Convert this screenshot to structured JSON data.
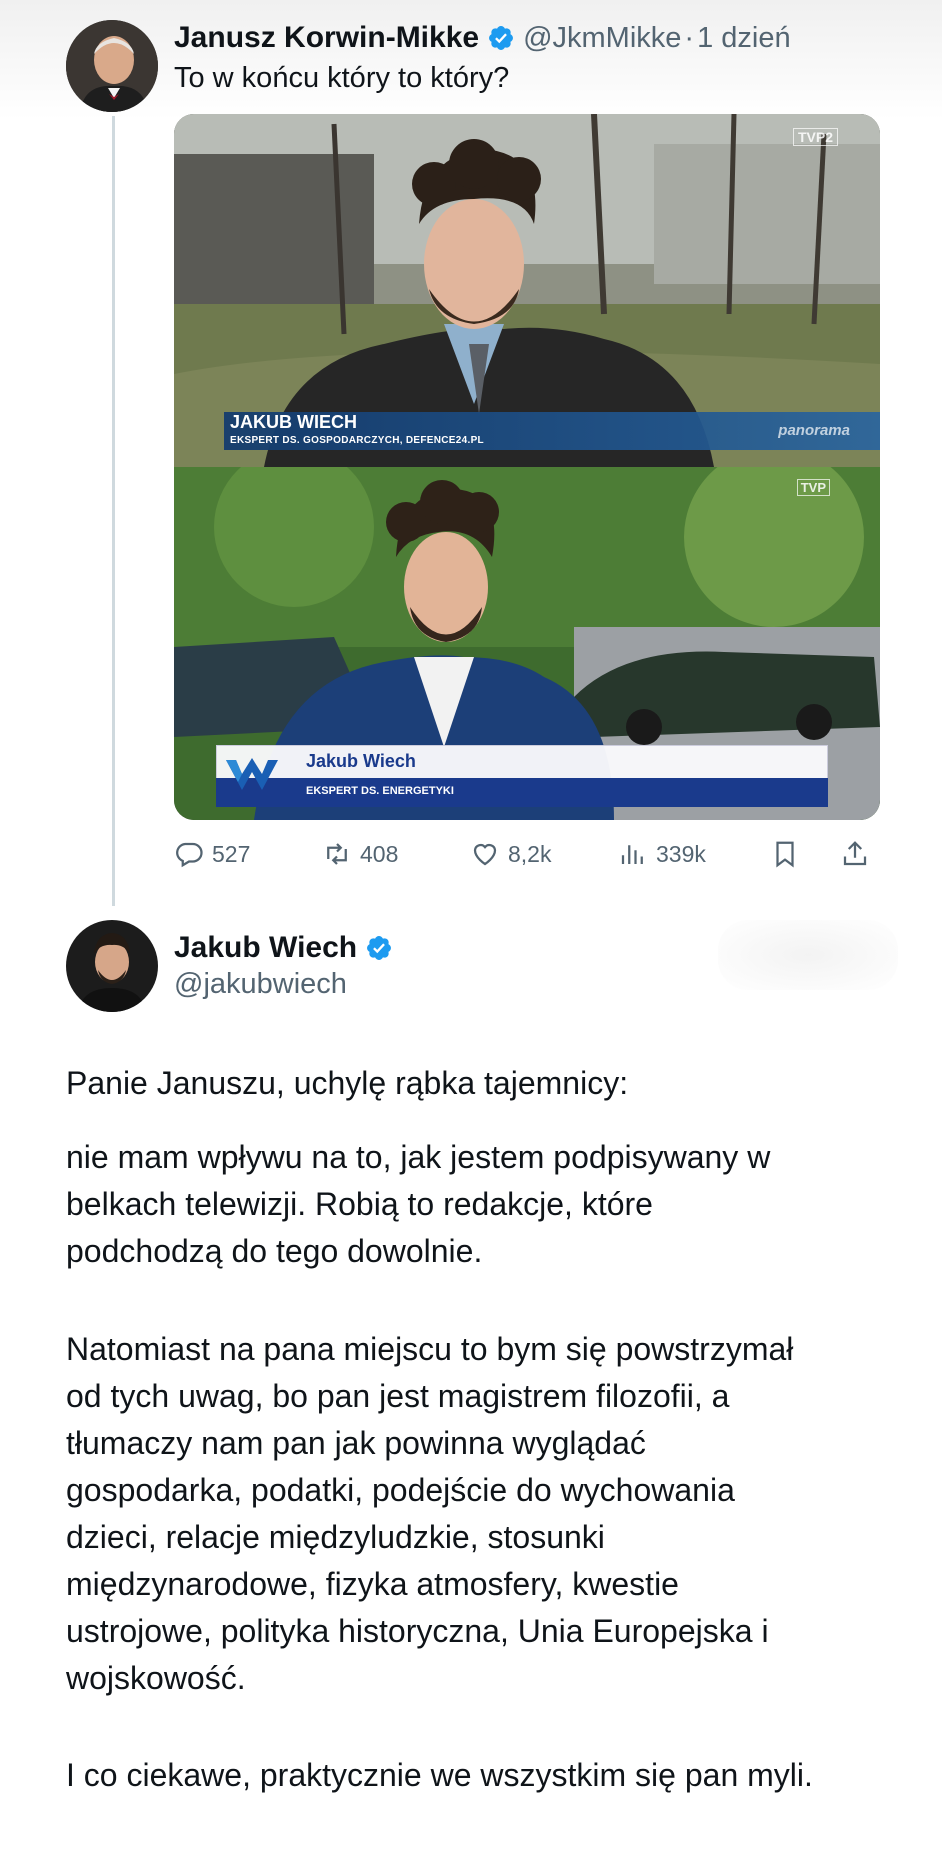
{
  "tweet1": {
    "author_name": "Janusz Korwin-Mikke",
    "handle": "@JkmMikke",
    "separator": "·",
    "time": "1 dzień",
    "text": "To w końcu który to który?",
    "media": {
      "frame1": {
        "channel_logo": "TVP2",
        "lower_third_name": "JAKUB WIECH",
        "lower_third_role": "EKSPERT DS. GOSPODARCZYCH, DEFENCE24.PL",
        "program_logo": "panorama"
      },
      "frame2": {
        "channel_logo": "TVP",
        "lower_third_name": "Jakub Wiech",
        "lower_third_role": "EKSPERT DS. ENERGETYKI"
      }
    },
    "actions": {
      "replies": "527",
      "reposts": "408",
      "likes": "8,2k",
      "views": "339k"
    }
  },
  "tweet2": {
    "author_name": "Jakub Wiech",
    "handle": "@jakubwiech",
    "paragraph1": "Panie Januszu, uchylę rąbka tajemnicy:",
    "paragraph2_lines": [
      "nie mam wpływu na to, jak jestem podpisywany w",
      "belkach telewizji. Robią to redakcje, które",
      "podchodzą do tego dowolnie."
    ],
    "paragraph3_lines": [
      "Natomiast na pana miejscu to bym się powstrzymał",
      "od tych uwag, bo pan jest magistrem filozofii, a",
      "tłumaczy nam pan jak powinna wyglądać",
      "gospodarka, podatki, podejście do wychowania",
      "dzieci, relacje międzyludzkie, stosunki",
      "międzynarodowe, fizyka atmosfery, kwestie",
      "ustrojowe, polityka historyczna, Unia Europejska i",
      "wojskowość."
    ],
    "paragraph4": "I co ciekawe, praktycznie we wszystkim się pan myli."
  },
  "icons": {
    "verified": "verified-badge-icon",
    "reply": "reply-icon",
    "repost": "repost-icon",
    "like": "heart-icon",
    "views": "views-icon",
    "bookmark": "bookmark-icon",
    "share": "share-icon"
  },
  "colors": {
    "verified": "#1d9bf0",
    "secondary_text": "#536471",
    "primary_text": "#0f1419",
    "thread_line": "#cfd9de"
  }
}
